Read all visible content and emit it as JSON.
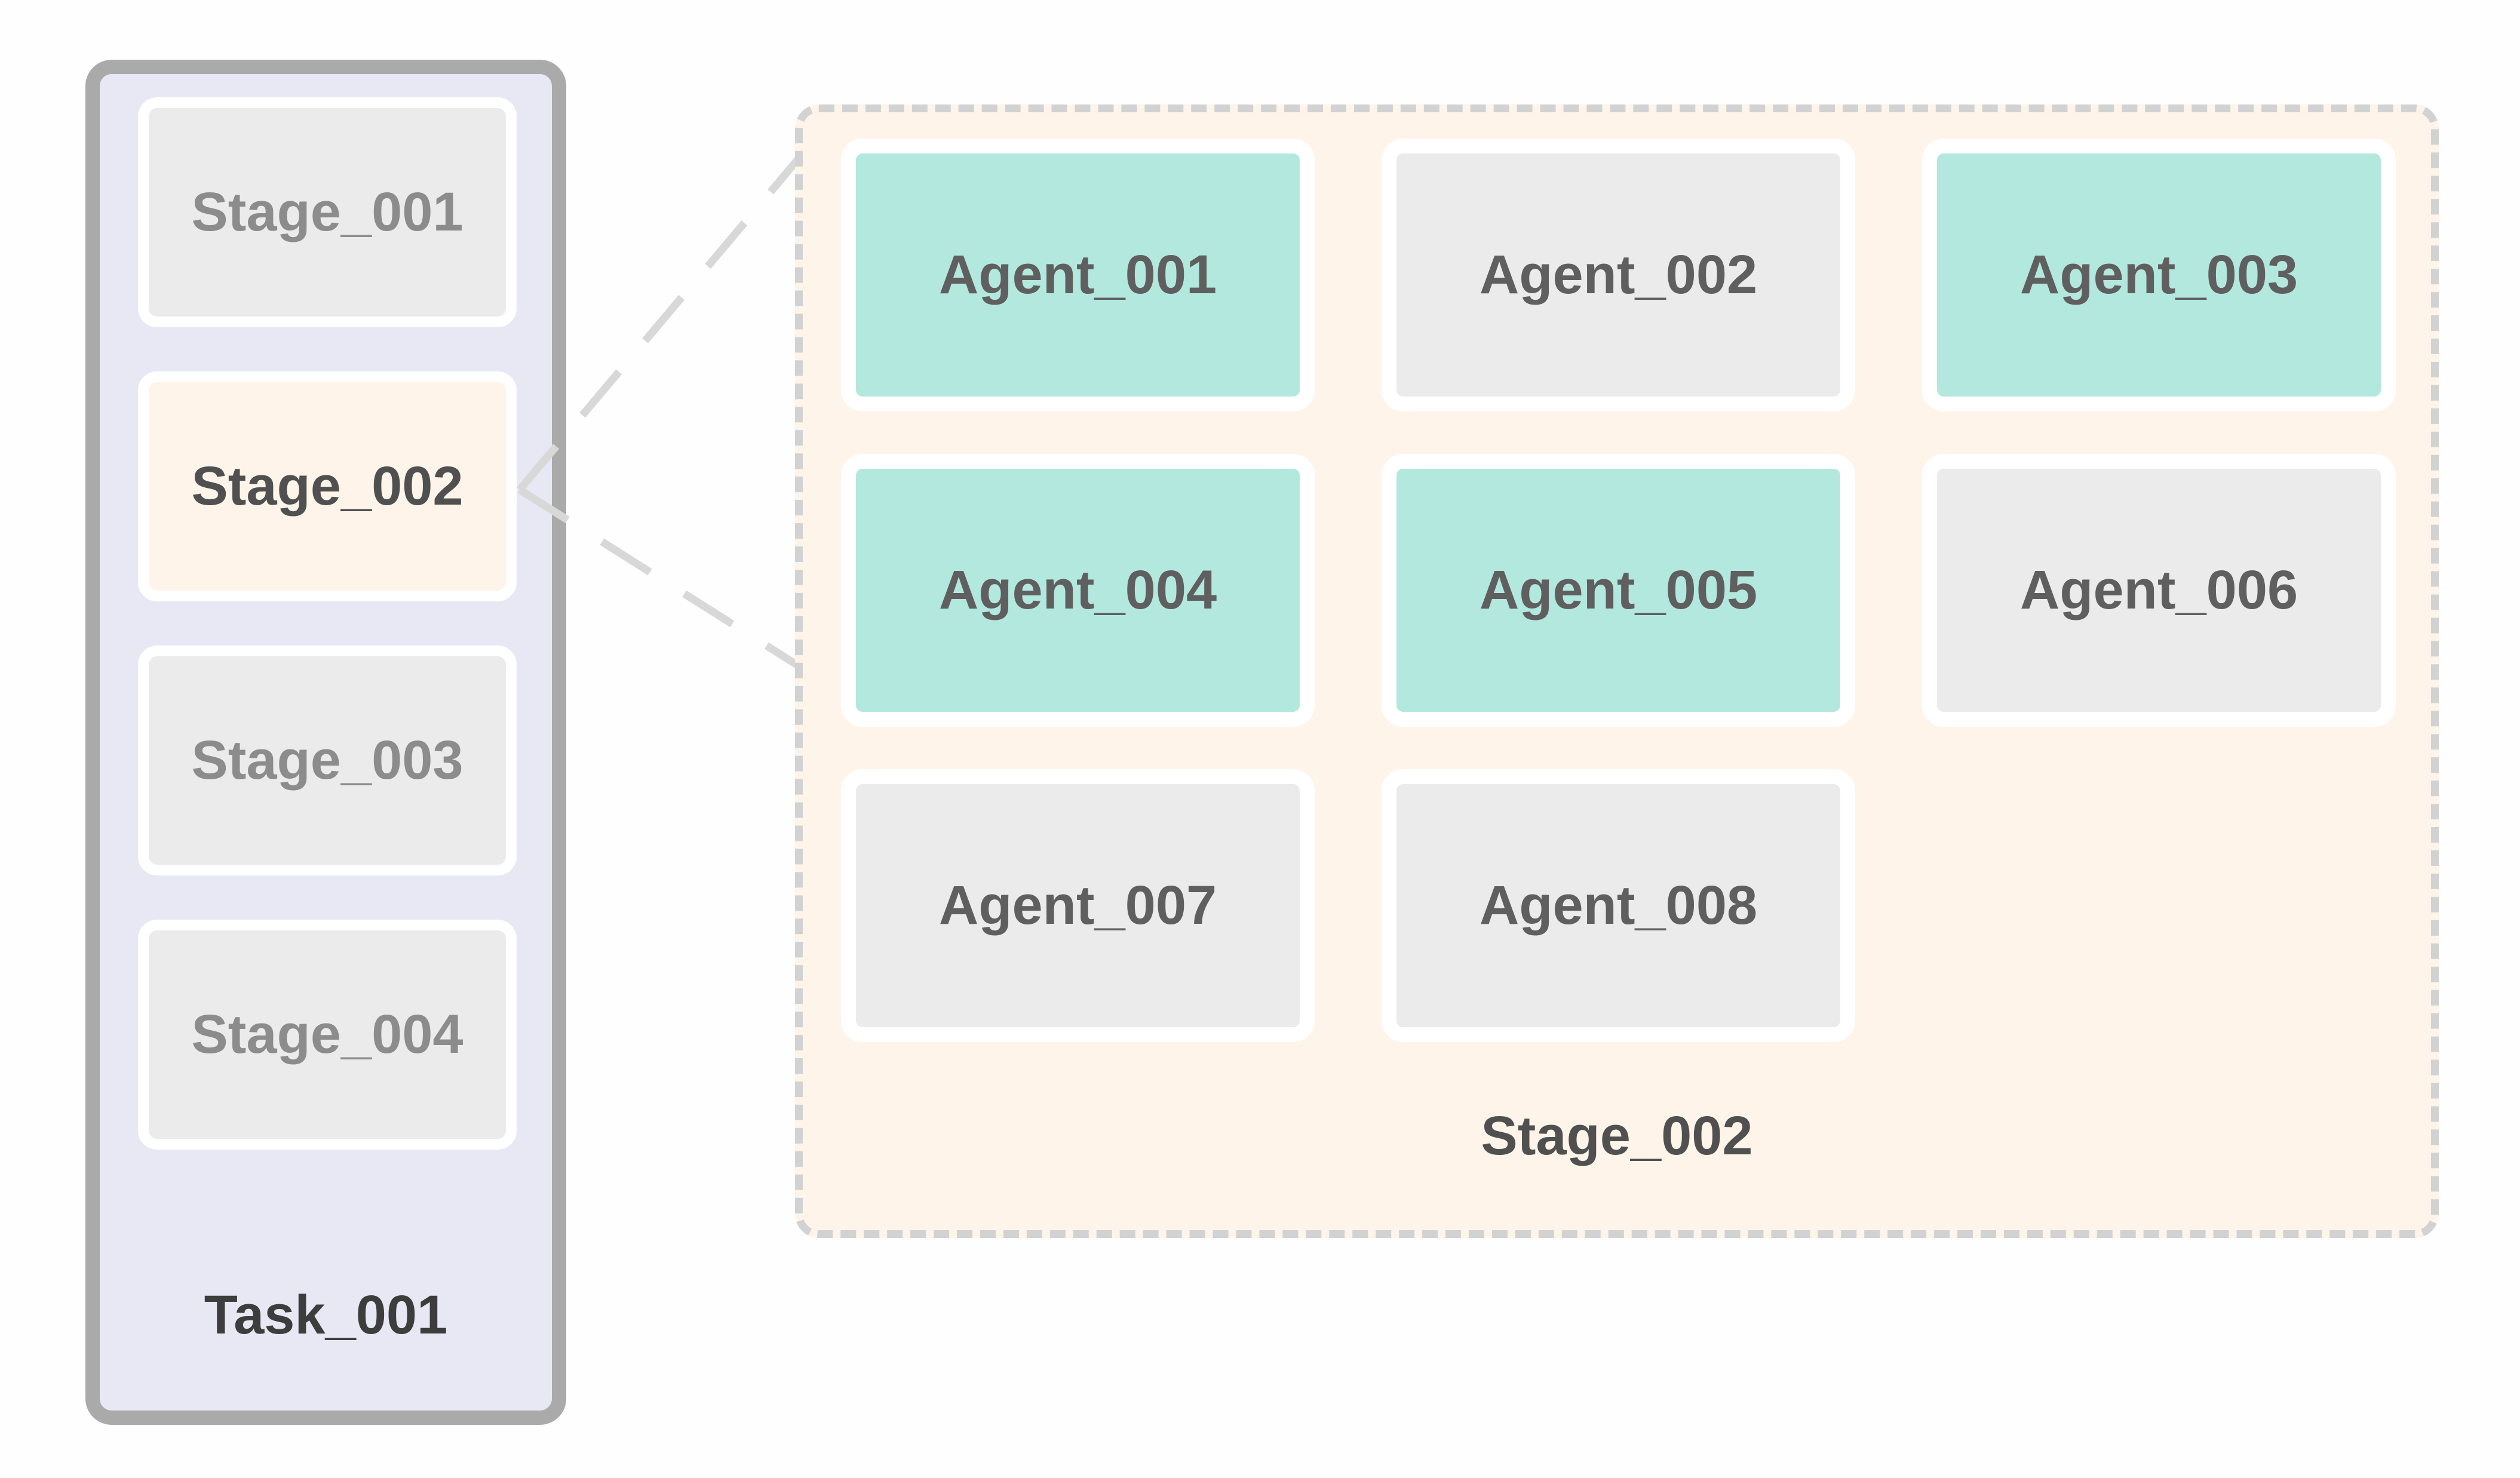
{
  "task": {
    "label": "Task_001",
    "stages": [
      {
        "label": "Stage_001",
        "active": false
      },
      {
        "label": "Stage_002",
        "active": true
      },
      {
        "label": "Stage_003",
        "active": false
      },
      {
        "label": "Stage_004",
        "active": false
      }
    ]
  },
  "expanded_stage": {
    "label": "Stage_002",
    "agents": [
      {
        "label": "Agent_001",
        "active": true
      },
      {
        "label": "Agent_002",
        "active": false
      },
      {
        "label": "Agent_003",
        "active": true
      },
      {
        "label": "Agent_004",
        "active": true
      },
      {
        "label": "Agent_005",
        "active": true
      },
      {
        "label": "Agent_006",
        "active": false
      },
      {
        "label": "Agent_007",
        "active": false
      },
      {
        "label": "Agent_008",
        "active": false
      }
    ]
  },
  "colors": {
    "task_panel_bg": "#e8e8f4",
    "task_panel_border": "#aaaaaa",
    "stage_inactive_bg": "#ebebeb",
    "stage_active_bg": "#fef4e9",
    "agent_active_bg": "#b3e8df",
    "agent_inactive_bg": "#ebebeb",
    "dashed_border": "#d2d2d2"
  }
}
